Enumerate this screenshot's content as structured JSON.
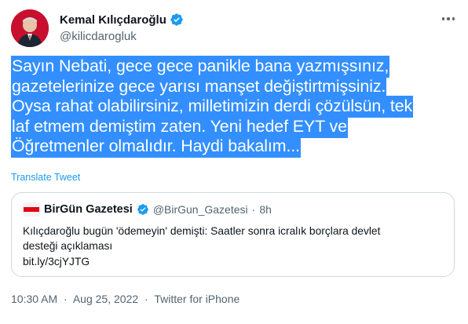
{
  "author": {
    "name": "Kemal Kılıçdaroğlu",
    "handle": "@kilicdarogluk"
  },
  "tweet": {
    "lines": [
      "Sayın Nebati, gece gece panikle bana yazmışsınız,",
      "gazetelerinize gece yarısı manşet değiştirtmişsiniz.",
      "Oysa rahat olabilirsiniz, milletimizin derdi çözülsün, tek",
      "laf etmem demiştim zaten. Yeni hedef EYT ve",
      "Öğretmenler olmalıdır. Haydi bakalım..."
    ],
    "translate_label": "Translate Tweet"
  },
  "quoted": {
    "name": "BirGün Gazetesi",
    "handle": "@BirGun_Gazetesi",
    "separator": "·",
    "time": "8h",
    "logo_text": "BirGün",
    "lines": [
      "Kılıçdaroğlu bugün 'ödemeyin' demişti: Saatler sonra icralık borçlara devlet",
      "desteği açıklaması",
      "bit.ly/3cjYJTG"
    ]
  },
  "meta": {
    "time": "10:30 AM",
    "sep1": "·",
    "date": "Aug 25, 2022",
    "sep2": "·",
    "source": "Twitter for iPhone"
  },
  "colors": {
    "highlight": "#338fff",
    "link": "#1d9bf0",
    "verified": "#1d9bf0",
    "secondary_text": "#536471"
  },
  "icons": [
    "verified-badge-icon",
    "more-options-icon"
  ]
}
